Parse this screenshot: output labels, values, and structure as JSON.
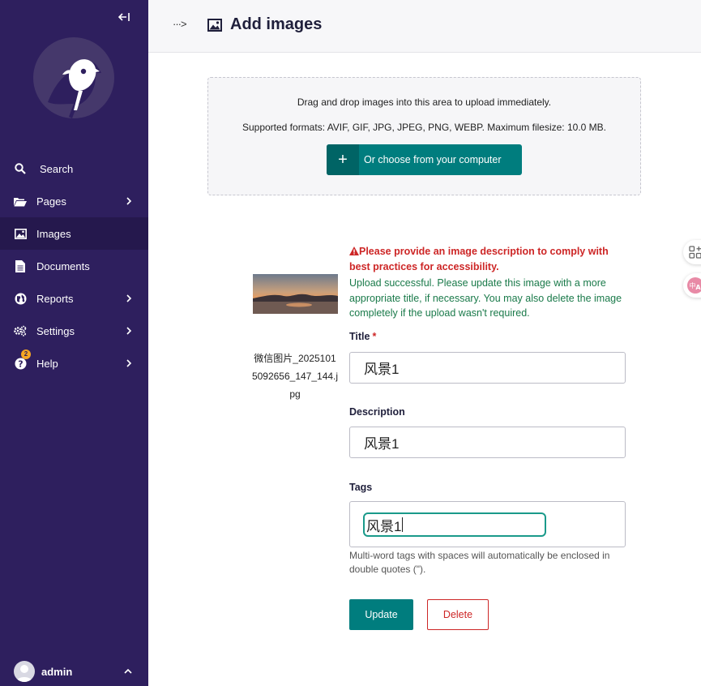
{
  "sidebar": {
    "collapse_icon": "collapse-left-icon",
    "logo": "wagtail-bird-logo",
    "items": [
      {
        "label": "Search",
        "icon": "search-icon"
      },
      {
        "label": "Pages",
        "icon": "folder-open-icon",
        "has_submenu": true
      },
      {
        "label": "Images",
        "icon": "image-icon",
        "active": true
      },
      {
        "label": "Documents",
        "icon": "document-icon"
      },
      {
        "label": "Reports",
        "icon": "globe-icon",
        "has_submenu": true
      },
      {
        "label": "Settings",
        "icon": "cogs-icon",
        "has_submenu": true
      },
      {
        "label": "Help",
        "icon": "help-icon",
        "has_submenu": true,
        "badge": "2"
      }
    ],
    "account": {
      "name": "admin"
    }
  },
  "header": {
    "breadcrumb_toggle": "···>",
    "title": "Add images",
    "title_icon": "image-icon"
  },
  "dropzone": {
    "line1": "Drag and drop images into this area to upload immediately.",
    "line2": "Supported formats: AVIF, GIF, JPG, JPEG, PNG, WEBP. Maximum filesize: 10.0 MB.",
    "button_icon": "+",
    "button_label": "Or choose from your computer"
  },
  "upload": {
    "filename": "微信图片_20251015092656_147_144.jpg",
    "warning": "Please provide an image description to comply with best practices for accessibility.",
    "success": "Upload successful. Please update this image with a more appropriate title, if necessary. You may also delete the image completely if the upload wasn't required.",
    "fields": {
      "title_label": "Title",
      "title_required": "*",
      "title_value": "风景1",
      "description_label": "Description",
      "description_value": "风景1",
      "tags_label": "Tags",
      "tags_value": "风景1",
      "tags_help": "Multi-word tags with spaces will automatically be enclosed in double quotes (\")."
    },
    "update_label": "Update",
    "delete_label": "Delete"
  },
  "colors": {
    "sidebar_bg": "#2e1f5e",
    "primary": "#007d7e",
    "error": "#cd2626",
    "success": "#1a7a4a"
  }
}
